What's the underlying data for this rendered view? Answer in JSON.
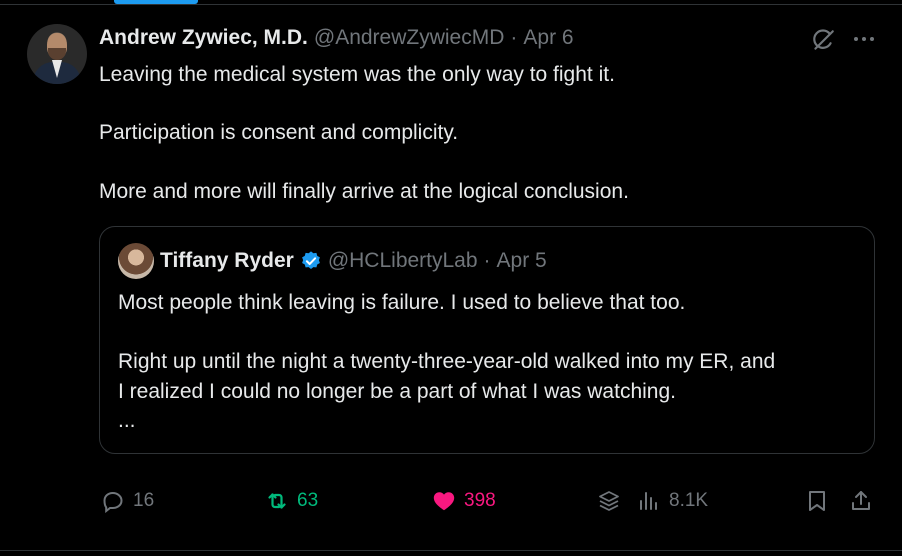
{
  "tweet": {
    "author_name": "Andrew Zywiec, M.D.",
    "author_handle": "@AndrewZywiecMD",
    "separator": "·",
    "date": "Apr 6",
    "text_lines": [
      "Leaving the medical system was the only way to fight it.",
      "Participation is consent and complicity.",
      "More and more will finally arrive at the logical conclusion."
    ]
  },
  "quoted_tweet": {
    "author_name": "Tiffany Ryder",
    "author_handle": "@HCLibertyLab",
    "separator": "·",
    "date": "Apr 5",
    "verified": true,
    "text_lines": [
      "Most people think leaving is failure. I used to believe that too.",
      "Right up until the night a twenty-three-year-old walked into my ER, and",
      "I realized I could no longer be a part of what I was watching.",
      "..."
    ]
  },
  "actions": {
    "replies": "16",
    "reposts": "63",
    "likes": "398",
    "views": "8.1K"
  },
  "colors": {
    "background": "#000000",
    "text": "#e7e9ea",
    "muted": "#71767b",
    "border": "#2f3336",
    "accent": "#1d9bf0",
    "repost": "#00ba7c",
    "like": "#f91880"
  },
  "icons": [
    "grok-icon",
    "more-icon",
    "verified-badge-icon",
    "reply-icon",
    "repost-icon",
    "like-icon",
    "grok-explain-icon",
    "views-icon",
    "bookmark-icon",
    "share-icon"
  ]
}
